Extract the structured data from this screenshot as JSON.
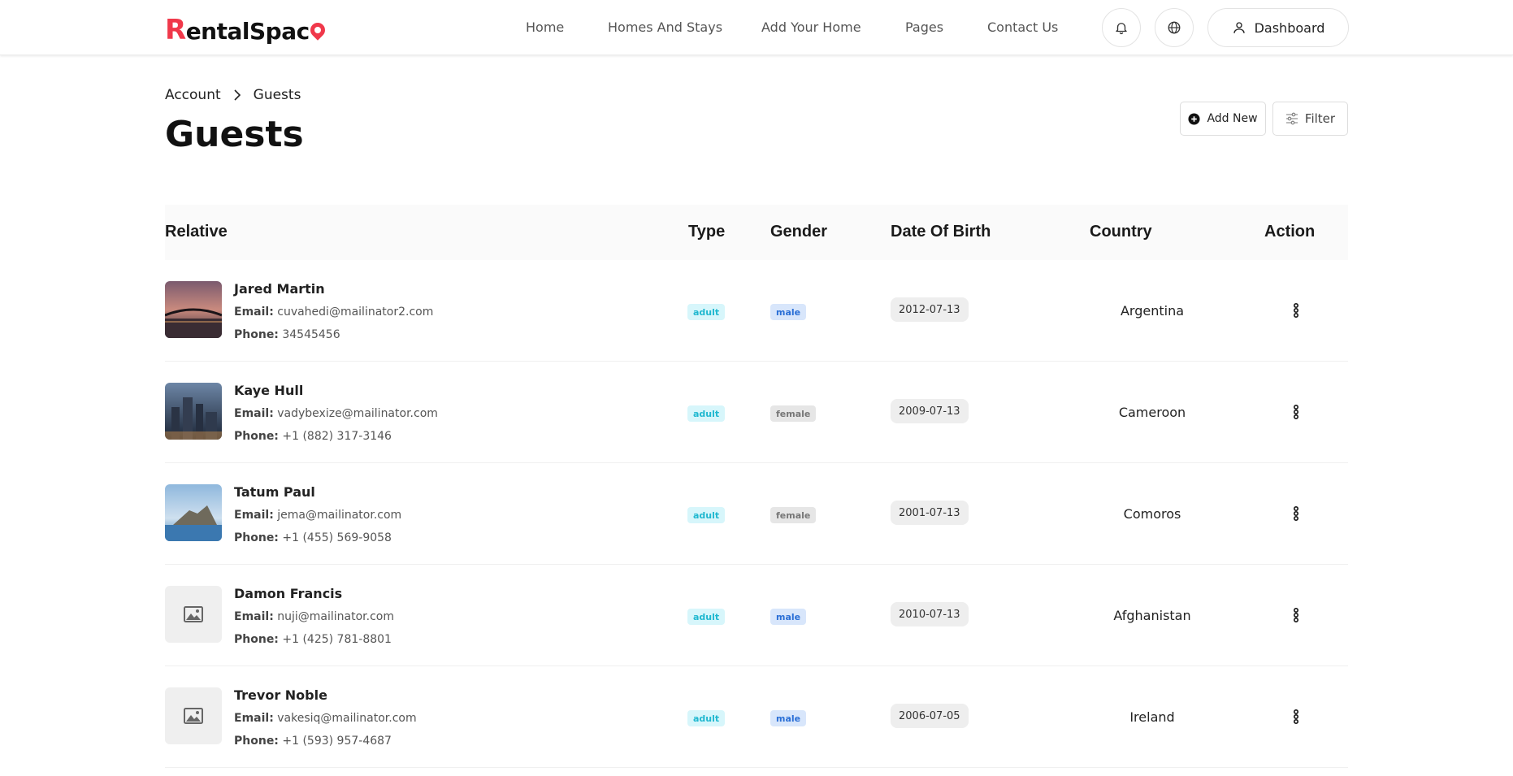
{
  "brand": {
    "logo_first": "R",
    "logo_rest": "entalSpac",
    "logo_last": "e",
    "accent": "#f0384a"
  },
  "nav": {
    "items": [
      "Home",
      "Homes And Stays",
      "Add Your Home",
      "Pages",
      "Contact Us"
    ],
    "dashboard_label": "Dashboard"
  },
  "breadcrumb": {
    "parent": "Account",
    "current": "Guests"
  },
  "page": {
    "title": "Guests",
    "add_label": "Add New",
    "filter_label": "Filter"
  },
  "table": {
    "headers": {
      "relative": "Relative",
      "type": "Type",
      "gender": "Gender",
      "dob": "Date Of Birth",
      "country": "Country",
      "action": "Action"
    },
    "email_label": "Email:",
    "phone_label": "Phone:",
    "rows": [
      {
        "name": "Jared Martin",
        "email": "cuvahedi@mailinator2.com",
        "phone": "34545456",
        "type": "adult",
        "gender": "male",
        "dob": "2012-07-13",
        "country": "Argentina",
        "image": "bridge-sunset"
      },
      {
        "name": "Kaye Hull",
        "email": "vadybexize@mailinator.com",
        "phone": "+1 (882) 317-3146",
        "type": "adult",
        "gender": "female",
        "dob": "2009-07-13",
        "country": "Cameroon",
        "image": "city-skyline"
      },
      {
        "name": "Tatum Paul",
        "email": "jema@mailinator.com",
        "phone": "+1 (455) 569-9058",
        "type": "adult",
        "gender": "female",
        "dob": "2001-07-13",
        "country": "Comoros",
        "image": "sea-rock"
      },
      {
        "name": "Damon Francis",
        "email": "nuji@mailinator.com",
        "phone": "+1 (425) 781-8801",
        "type": "adult",
        "gender": "male",
        "dob": "2010-07-13",
        "country": "Afghanistan",
        "image": "placeholder"
      },
      {
        "name": "Trevor Noble",
        "email": "vakesiq@mailinator.com",
        "phone": "+1 (593) 957-4687",
        "type": "adult",
        "gender": "male",
        "dob": "2006-07-05",
        "country": "Ireland",
        "image": "placeholder"
      }
    ]
  }
}
